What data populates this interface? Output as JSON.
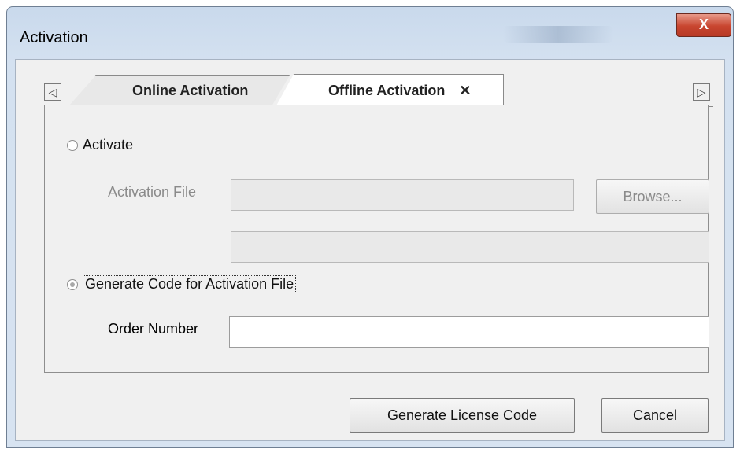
{
  "window": {
    "title": "Activation",
    "close_label": "X"
  },
  "tabs": {
    "scroll_left": "◁",
    "scroll_right": "▷",
    "items": [
      {
        "label": "Online Activation",
        "active": false
      },
      {
        "label": "Offline Activation",
        "active": true,
        "close": "✕"
      }
    ]
  },
  "activate": {
    "radio_label": "Activate",
    "file_label": "Activation File",
    "file_value": "",
    "browse_label": "Browse...",
    "second_value": ""
  },
  "generate": {
    "radio_label": "Generate Code for Activation File",
    "order_label": "Order Number",
    "order_value": ""
  },
  "footer": {
    "generate_label": "Generate License Code",
    "cancel_label": "Cancel"
  }
}
